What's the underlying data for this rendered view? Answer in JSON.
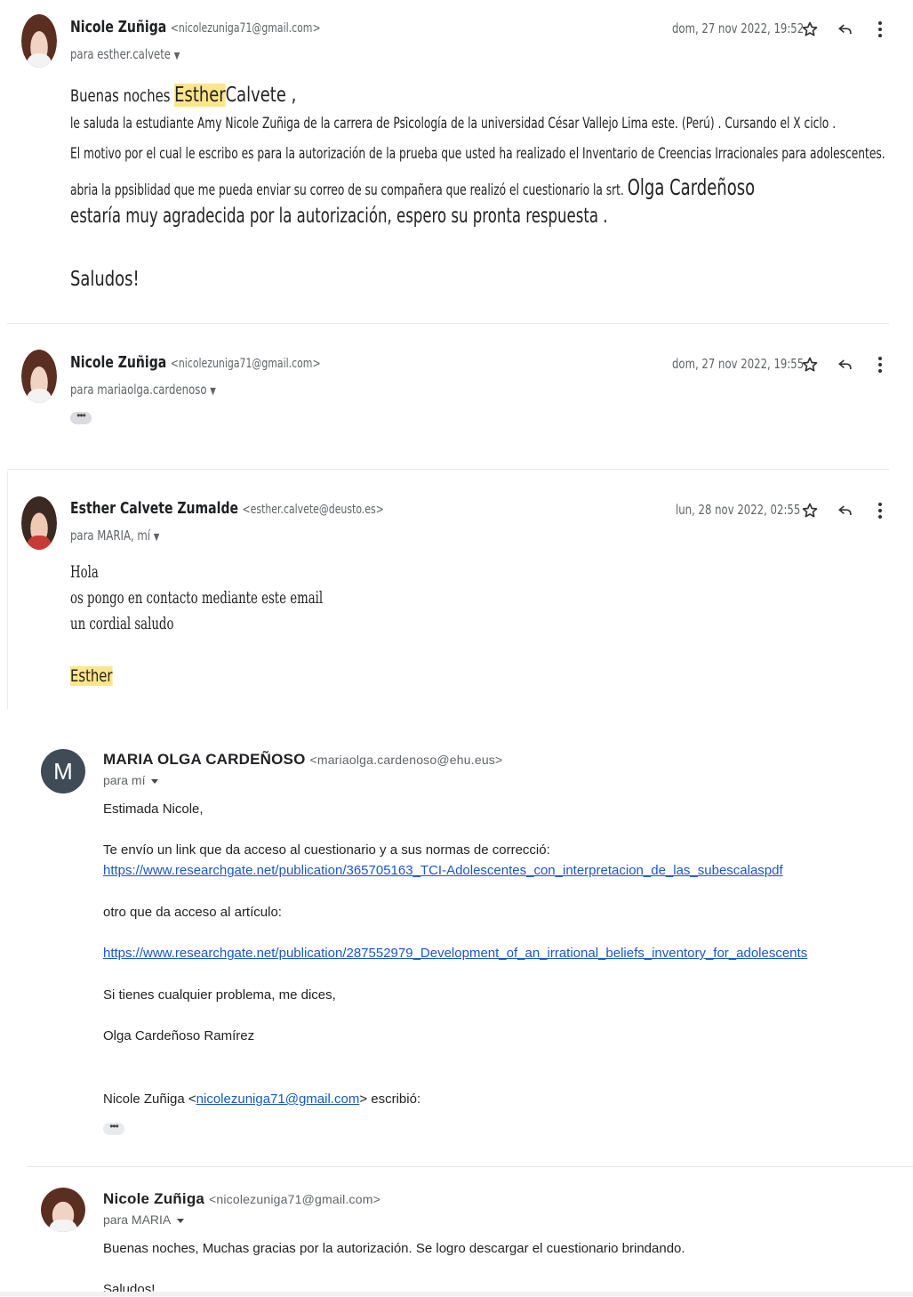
{
  "messages": [
    {
      "sender": "Nicole Zuñiga",
      "email": "<nicolezuniga71@gmail.com>",
      "to": "para esther.calvete",
      "date": "dom, 27 nov 2022, 19:52",
      "greeting_prefix": "Buenas noches",
      "greeting_name": "Esther",
      "greeting_surname": "Calvete ,",
      "lines": [
        "le saluda la estudiante Amy Nicole Zuñiga de la carrera de Psicología de la universidad César Vallejo Lima este. (Perú) . Cursando el X ciclo .",
        "El motivo por el cual le escribo es para la autorización de la prueba que usted ha realizado el Inventario de Creencias Irracionales para adolescentes.",
        "abria la ppsiblidad que me pueda enviar su correo de su compañera que realizó el cuestionario la srt."
      ],
      "line3_name": "Olga Cardeñoso",
      "line4": "estaría muy agradecida por la autorización, espero su pronta respuesta .",
      "closing": "Saludos!"
    },
    {
      "sender": "Nicole Zuñiga",
      "email": "<nicolezuniga71@gmail.com>",
      "to": "para mariaolga.cardenoso",
      "date": "dom, 27 nov 2022, 19:55",
      "trimmed": "•••"
    },
    {
      "sender": "Esther Calvete Zumalde",
      "email": "<esther.calvete@deusto.es>",
      "to": "para MARIA, mí",
      "date": "lun, 28 nov 2022, 02:55",
      "body": [
        "Hola",
        "os pongo en contacto mediante este email",
        "un cordial saludo"
      ],
      "signature": "Esther"
    }
  ],
  "icons": {
    "star": "star-icon",
    "reply": "reply-icon",
    "more": "more-vert-icon"
  },
  "reply_thread": [
    {
      "avatar_letter": "M",
      "sender": "MARIA OLGA CARDEÑOSO",
      "email": "<mariaolga.cardenoso@ehu.eus>",
      "to": "para mí",
      "greeting": "Estimada Nicole,",
      "intro": "Te envío un link que da acceso al cuestionario y a sus normas de correcció:",
      "link1": "https://www.researchgate.net/publication/365705163_TCI-Adolescentes_con_interpretacion_de_las_subescalaspdf",
      "other": "otro que da acceso al artículo:",
      "link2": "https://www.researchgate.net/publication/287552979_Development_of_an_irrational_beliefs_inventory_for_adolescents",
      "problem": "Si tienes cualquier problema, me dices,",
      "signature": "Olga Cardeñoso Ramírez",
      "quote_prefix": "Nicole Zuñiga <",
      "quote_email": "nicolezuniga71@gmail.com",
      "quote_suffix": "> escribió:",
      "trimmed": "•••"
    },
    {
      "sender": "Nicole Zuñiga",
      "email": "<nicolezuniga71@gmail.com>",
      "to": "para MARIA",
      "body": "Buenas noches, Muchas gracias por la autorización. Se logro descargar el cuestionario brindando.",
      "closing": "Saludos!"
    }
  ],
  "colors": {
    "highlight": "#fde58a",
    "link": "#1a57c9",
    "avatar_m": "#3f4b57"
  }
}
